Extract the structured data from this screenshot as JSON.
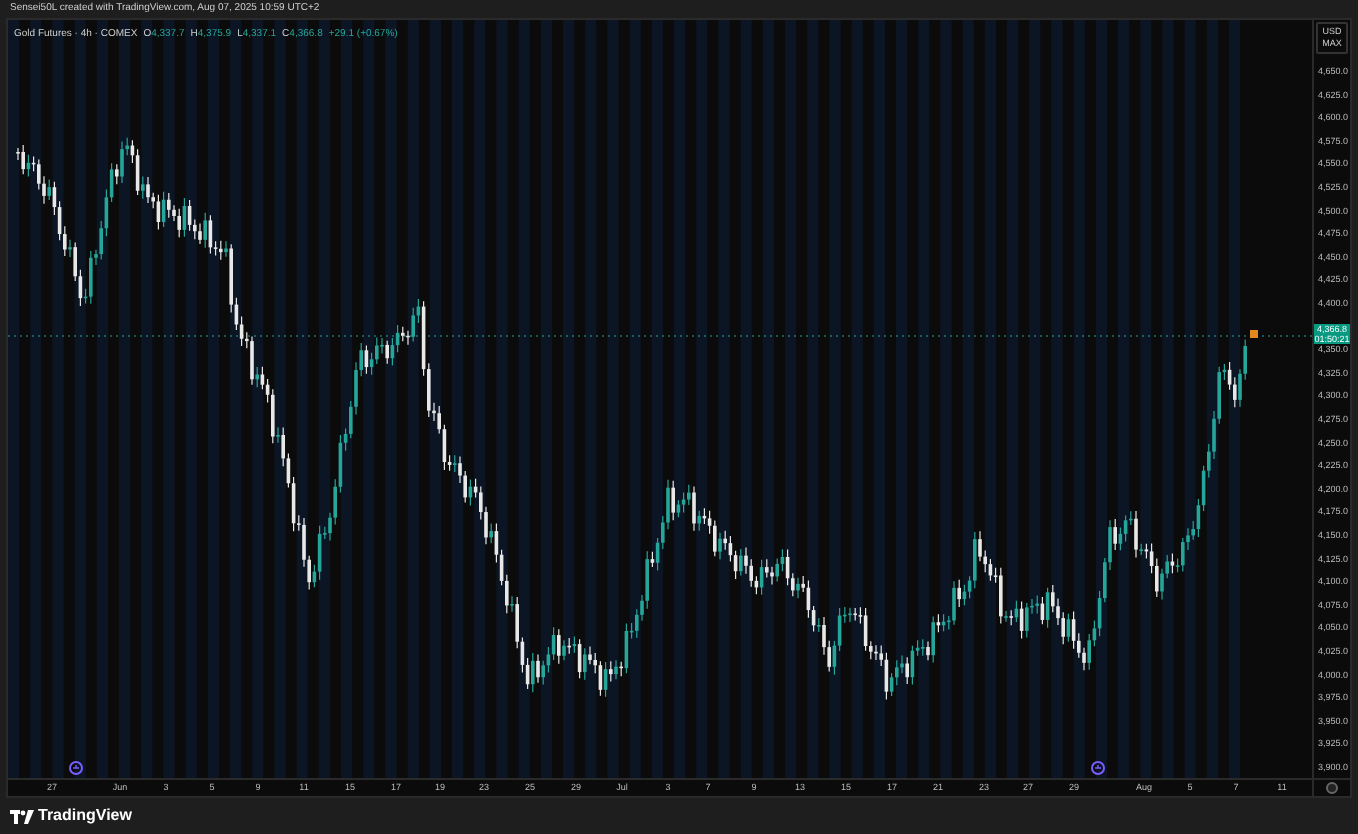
{
  "header": {
    "caption": "Sensei50L created with TradingView.com, Aug 07, 2025 10:59 UTC+2"
  },
  "legend": {
    "symbol": "Gold Futures · 4h · COMEX",
    "ohlc": [
      {
        "label": "O",
        "value": "4,337.7"
      },
      {
        "label": "H",
        "value": "4,375.9"
      },
      {
        "label": "L",
        "value": "4,337.1"
      },
      {
        "label": "C",
        "value": "4,366.8"
      }
    ],
    "change": "+29.1 (+0.67%)"
  },
  "price_axis": {
    "currency": "USD",
    "unit": "MAX",
    "ticks": [
      "4,650.0",
      "4,625.0",
      "4,600.0",
      "4,575.0",
      "4,550.0",
      "4,525.0",
      "4,500.0",
      "4,475.0",
      "4,450.0",
      "4,425.0",
      "4,400.0",
      "4,350.0",
      "4,325.0",
      "4,300.0",
      "4,275.0",
      "4,250.0",
      "4,225.0",
      "4,200.0",
      "4,175.0",
      "4,150.0",
      "4,125.0",
      "4,100.0",
      "4,075.0",
      "4,050.0",
      "4,025.0",
      "4,000.0",
      "3,975.0",
      "3,950.0",
      "3,925.0",
      "3,900.0"
    ],
    "last_price": "4,366.8",
    "countdown": "01:50:21"
  },
  "time_axis": {
    "labels": [
      "27",
      "Jun",
      "3",
      "5",
      "9",
      "11",
      "15",
      "17",
      "19",
      "23",
      "25",
      "29",
      "Jul",
      "3",
      "7",
      "9",
      "13",
      "15",
      "17",
      "21",
      "23",
      "27",
      "29",
      "Aug",
      "5",
      "7",
      "11"
    ]
  },
  "footer": {
    "brand": "TradingView"
  }
}
